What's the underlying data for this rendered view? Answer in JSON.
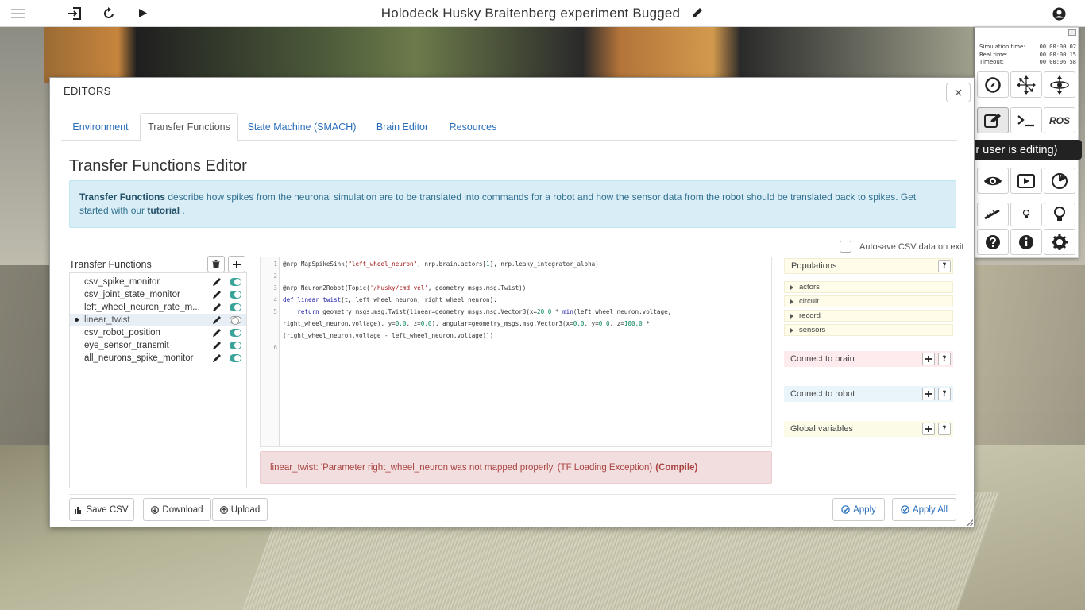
{
  "topbar": {
    "title": "Holodeck Husky Braitenberg experiment Bugged"
  },
  "sim_times": [
    {
      "label": "Simulation time:",
      "value": "00 00:00:02"
    },
    {
      "label": "Real time:",
      "value": "00 00:00:15"
    },
    {
      "label": "Timeout:",
      "value": "00 00:06:58"
    }
  ],
  "side_panel": {
    "ros_label": "ROS"
  },
  "tooltip": "Toggle experiment editors (Unavailable if another user is editing)",
  "editor": {
    "window_title": "EDITORS",
    "close_label": "×",
    "tabs": [
      "Environment",
      "Transfer Functions",
      "State Machine (SMACH)",
      "Brain Editor",
      "Resources"
    ],
    "heading": "Transfer Functions Editor",
    "info_strong": "Transfer Functions",
    "info_text": " describe how spikes from the neuronal simulation are to be translated into commands for a robot and how the sensor data from the robot should be translated back to spikes. Get started with our ",
    "info_link": "tutorial",
    "info_end": " .",
    "autosave_label": "Autosave CSV data on exit",
    "tf_label": "Transfer Functions",
    "tf_items": [
      {
        "name": "csv_spike_monitor",
        "enabled": true
      },
      {
        "name": "csv_joint_state_monitor",
        "enabled": true
      },
      {
        "name": "left_wheel_neuron_rate_m...",
        "enabled": true
      },
      {
        "name": "linear_twist",
        "enabled": false
      },
      {
        "name": "csv_robot_position",
        "enabled": true
      },
      {
        "name": "eye_sensor_transmit",
        "enabled": true
      },
      {
        "name": "all_neurons_spike_monitor",
        "enabled": true
      }
    ],
    "selected_item": "linear_twist",
    "line_numbers": [
      "1",
      "2",
      "3",
      "4",
      "5",
      "",
      "",
      "6"
    ],
    "error_text": "linear_twist: 'Parameter right_wheel_neuron was not mapped properly' (TF Loading Exception)",
    "error_action": "(Compile)",
    "populations_label": "Populations",
    "populations": [
      "actors",
      "circuit",
      "record",
      "sensors"
    ],
    "connect_brain_label": "Connect to brain",
    "connect_robot_label": "Connect to robot",
    "global_vars_label": "Global variables",
    "help_label": "?",
    "buttons": {
      "save_csv": "Save CSV",
      "download": "Download",
      "upload": "Upload",
      "apply": "Apply",
      "apply_all": "Apply All"
    }
  },
  "colors": {
    "accent": "#2a6ebb",
    "info_bg": "#d9edf7",
    "error_bg": "#f2dede",
    "toggle_on": "#3aa39a"
  }
}
